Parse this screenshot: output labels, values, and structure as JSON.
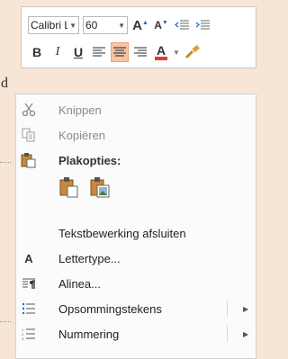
{
  "document": {
    "partial_text": "d"
  },
  "mini_toolbar": {
    "font_name": "Calibri Li",
    "font_size": "60",
    "buttons": {
      "bold": "B",
      "italic": "I",
      "underline": "U",
      "font_color": "A"
    },
    "grow_font_glyph": "A",
    "shrink_font_glyph": "A",
    "accent_color": "#e23b2c"
  },
  "context_menu": {
    "items": [
      {
        "label": "Knippen",
        "icon": "scissors-icon",
        "state": "disabled"
      },
      {
        "label": "Kopiëren",
        "icon": "copy-icon",
        "state": "disabled"
      },
      {
        "label": "Plakopties:",
        "icon": "paste-icon",
        "state": "header"
      },
      {
        "label": "Tekstbewerking afsluiten",
        "icon": "",
        "state": "normal"
      },
      {
        "label": "Lettertype...",
        "icon": "font-icon",
        "state": "normal"
      },
      {
        "label": "Alinea...",
        "icon": "paragraph-icon",
        "state": "normal"
      },
      {
        "label": "Opsommingstekens",
        "icon": "bullets-icon",
        "state": "normal",
        "submenu": true
      },
      {
        "label": "Nummering",
        "icon": "numbering-icon",
        "state": "normal",
        "submenu": true
      }
    ],
    "paste_options": [
      "keep-source-formatting",
      "picture"
    ],
    "highlight_color": "#f4c4a4"
  }
}
